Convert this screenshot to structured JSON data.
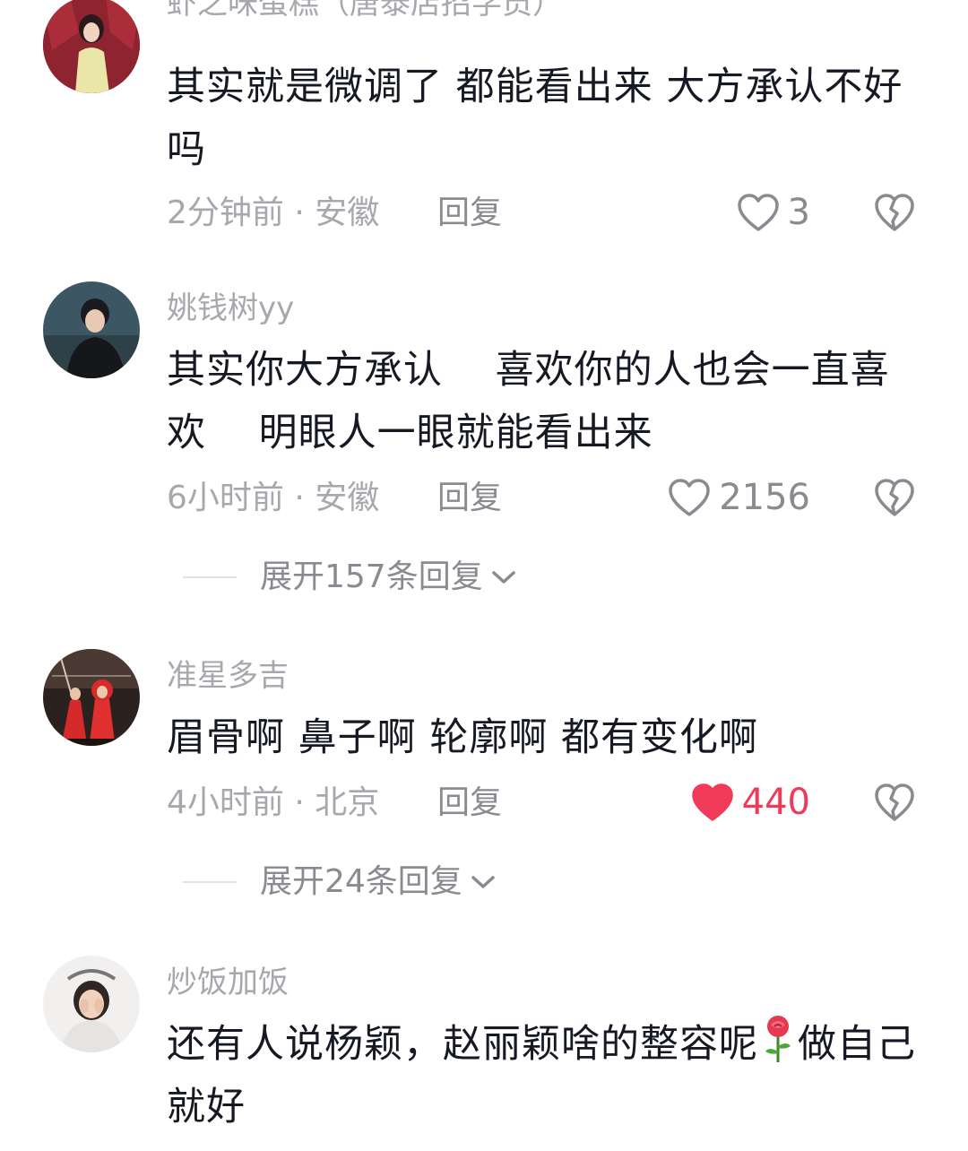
{
  "comments": [
    {
      "username": "虾之味蛋糕（唐泰店招学员）",
      "text": "其实就是微调了 都能看出来 大方承认不好吗",
      "time": "2分钟前",
      "location": "安徽",
      "reply": "回复",
      "likes": "3",
      "liked": false
    },
    {
      "username": "姚钱树yy",
      "text": "其实你大方承认    喜欢你的人也会一直喜欢    明眼人一眼就能看出来",
      "time": "6小时前",
      "location": "安徽",
      "reply": "回复",
      "likes": "2156",
      "liked": false,
      "expand": "展开157条回复"
    },
    {
      "username": "准星多吉",
      "text": "眉骨啊 鼻子啊 轮廓啊 都有变化啊",
      "time": "4小时前",
      "location": "北京",
      "reply": "回复",
      "likes": "440",
      "liked": true,
      "expand": "展开24条回复"
    },
    {
      "username": "炒饭加饭",
      "text_before_emoji": "还有人说杨颖，赵丽颖啥的整容呢",
      "emoji": "rose-emoji",
      "text_after_emoji": "做自己就好"
    }
  ],
  "meta_separator": " · ",
  "icons": {
    "like": "heart-outline-icon",
    "liked": "heart-filled-icon",
    "dislike": "broken-heart-icon",
    "expand": "chevron-down-icon"
  },
  "colors": {
    "liked": "#f13a5a",
    "muted": "#a7a7ad",
    "text": "#161823"
  }
}
